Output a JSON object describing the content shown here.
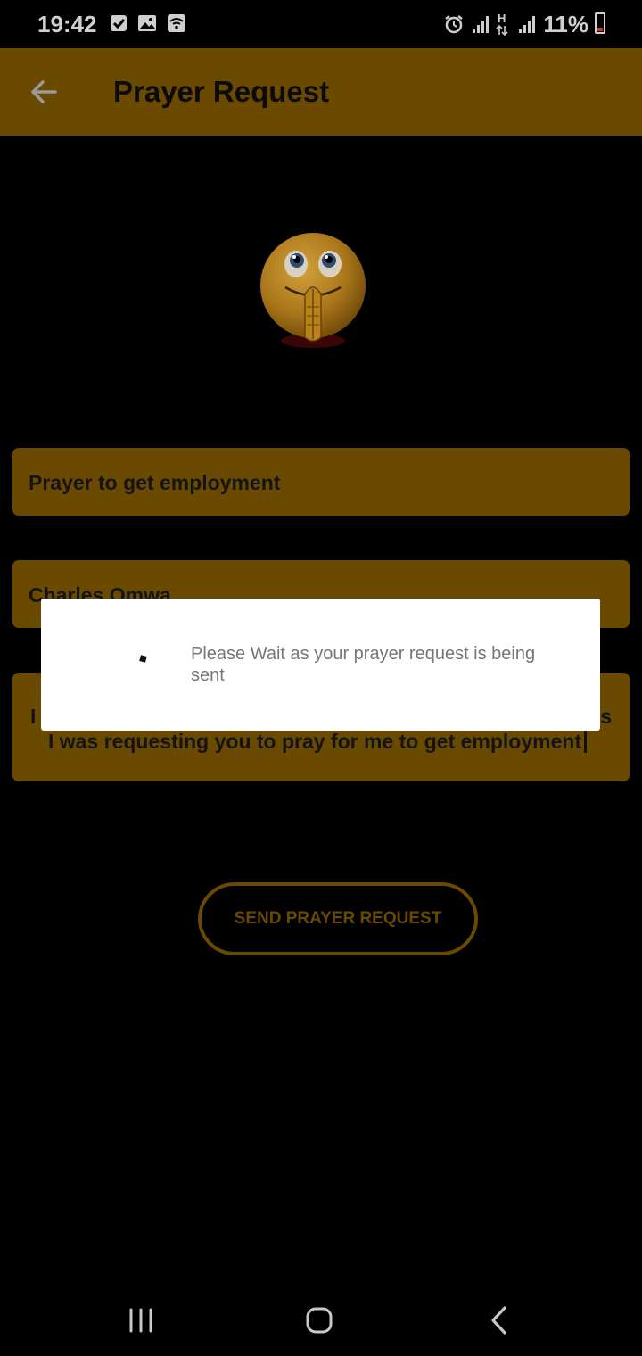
{
  "status_bar": {
    "time": "19:42",
    "battery": "11%",
    "network_label": "H"
  },
  "app_bar": {
    "title": "Prayer Request",
    "back_icon": "arrow-left-icon"
  },
  "emoji": "praying-emoji",
  "form": {
    "subject_value": "Prayer to get employment",
    "name_value": "Charles Omwa",
    "message_line1_start": "I",
    "message_line1_end": "s",
    "message_line2": "I was requesting you to pray for me to get employment"
  },
  "send_button_label": "SEND PRAYER REQUEST",
  "dialog": {
    "message": "Please Wait as your prayer request is being sent"
  },
  "colors": {
    "accent": "#6a4a00",
    "background": "#000000",
    "dialog_text": "#777777"
  }
}
